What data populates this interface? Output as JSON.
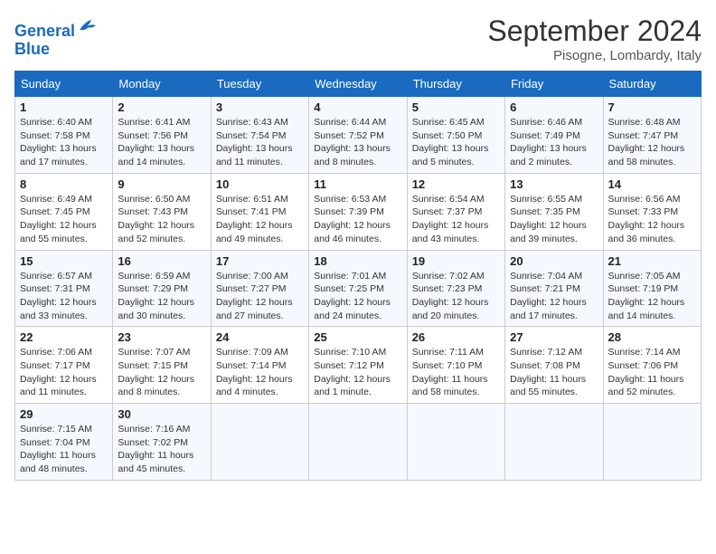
{
  "header": {
    "logo_line1": "General",
    "logo_line2": "Blue",
    "month": "September 2024",
    "location": "Pisogne, Lombardy, Italy"
  },
  "columns": [
    "Sunday",
    "Monday",
    "Tuesday",
    "Wednesday",
    "Thursday",
    "Friday",
    "Saturday"
  ],
  "weeks": [
    [
      {
        "day": "1",
        "sunrise": "6:40 AM",
        "sunset": "7:58 PM",
        "daylight": "13 hours and 17 minutes."
      },
      {
        "day": "2",
        "sunrise": "6:41 AM",
        "sunset": "7:56 PM",
        "daylight": "13 hours and 14 minutes."
      },
      {
        "day": "3",
        "sunrise": "6:43 AM",
        "sunset": "7:54 PM",
        "daylight": "13 hours and 11 minutes."
      },
      {
        "day": "4",
        "sunrise": "6:44 AM",
        "sunset": "7:52 PM",
        "daylight": "13 hours and 8 minutes."
      },
      {
        "day": "5",
        "sunrise": "6:45 AM",
        "sunset": "7:50 PM",
        "daylight": "13 hours and 5 minutes."
      },
      {
        "day": "6",
        "sunrise": "6:46 AM",
        "sunset": "7:49 PM",
        "daylight": "13 hours and 2 minutes."
      },
      {
        "day": "7",
        "sunrise": "6:48 AM",
        "sunset": "7:47 PM",
        "daylight": "12 hours and 58 minutes."
      }
    ],
    [
      {
        "day": "8",
        "sunrise": "6:49 AM",
        "sunset": "7:45 PM",
        "daylight": "12 hours and 55 minutes."
      },
      {
        "day": "9",
        "sunrise": "6:50 AM",
        "sunset": "7:43 PM",
        "daylight": "12 hours and 52 minutes."
      },
      {
        "day": "10",
        "sunrise": "6:51 AM",
        "sunset": "7:41 PM",
        "daylight": "12 hours and 49 minutes."
      },
      {
        "day": "11",
        "sunrise": "6:53 AM",
        "sunset": "7:39 PM",
        "daylight": "12 hours and 46 minutes."
      },
      {
        "day": "12",
        "sunrise": "6:54 AM",
        "sunset": "7:37 PM",
        "daylight": "12 hours and 43 minutes."
      },
      {
        "day": "13",
        "sunrise": "6:55 AM",
        "sunset": "7:35 PM",
        "daylight": "12 hours and 39 minutes."
      },
      {
        "day": "14",
        "sunrise": "6:56 AM",
        "sunset": "7:33 PM",
        "daylight": "12 hours and 36 minutes."
      }
    ],
    [
      {
        "day": "15",
        "sunrise": "6:57 AM",
        "sunset": "7:31 PM",
        "daylight": "12 hours and 33 minutes."
      },
      {
        "day": "16",
        "sunrise": "6:59 AM",
        "sunset": "7:29 PM",
        "daylight": "12 hours and 30 minutes."
      },
      {
        "day": "17",
        "sunrise": "7:00 AM",
        "sunset": "7:27 PM",
        "daylight": "12 hours and 27 minutes."
      },
      {
        "day": "18",
        "sunrise": "7:01 AM",
        "sunset": "7:25 PM",
        "daylight": "12 hours and 24 minutes."
      },
      {
        "day": "19",
        "sunrise": "7:02 AM",
        "sunset": "7:23 PM",
        "daylight": "12 hours and 20 minutes."
      },
      {
        "day": "20",
        "sunrise": "7:04 AM",
        "sunset": "7:21 PM",
        "daylight": "12 hours and 17 minutes."
      },
      {
        "day": "21",
        "sunrise": "7:05 AM",
        "sunset": "7:19 PM",
        "daylight": "12 hours and 14 minutes."
      }
    ],
    [
      {
        "day": "22",
        "sunrise": "7:06 AM",
        "sunset": "7:17 PM",
        "daylight": "12 hours and 11 minutes."
      },
      {
        "day": "23",
        "sunrise": "7:07 AM",
        "sunset": "7:15 PM",
        "daylight": "12 hours and 8 minutes."
      },
      {
        "day": "24",
        "sunrise": "7:09 AM",
        "sunset": "7:14 PM",
        "daylight": "12 hours and 4 minutes."
      },
      {
        "day": "25",
        "sunrise": "7:10 AM",
        "sunset": "7:12 PM",
        "daylight": "12 hours and 1 minute."
      },
      {
        "day": "26",
        "sunrise": "7:11 AM",
        "sunset": "7:10 PM",
        "daylight": "11 hours and 58 minutes."
      },
      {
        "day": "27",
        "sunrise": "7:12 AM",
        "sunset": "7:08 PM",
        "daylight": "11 hours and 55 minutes."
      },
      {
        "day": "28",
        "sunrise": "7:14 AM",
        "sunset": "7:06 PM",
        "daylight": "11 hours and 52 minutes."
      }
    ],
    [
      {
        "day": "29",
        "sunrise": "7:15 AM",
        "sunset": "7:04 PM",
        "daylight": "11 hours and 48 minutes."
      },
      {
        "day": "30",
        "sunrise": "7:16 AM",
        "sunset": "7:02 PM",
        "daylight": "11 hours and 45 minutes."
      },
      null,
      null,
      null,
      null,
      null
    ]
  ]
}
